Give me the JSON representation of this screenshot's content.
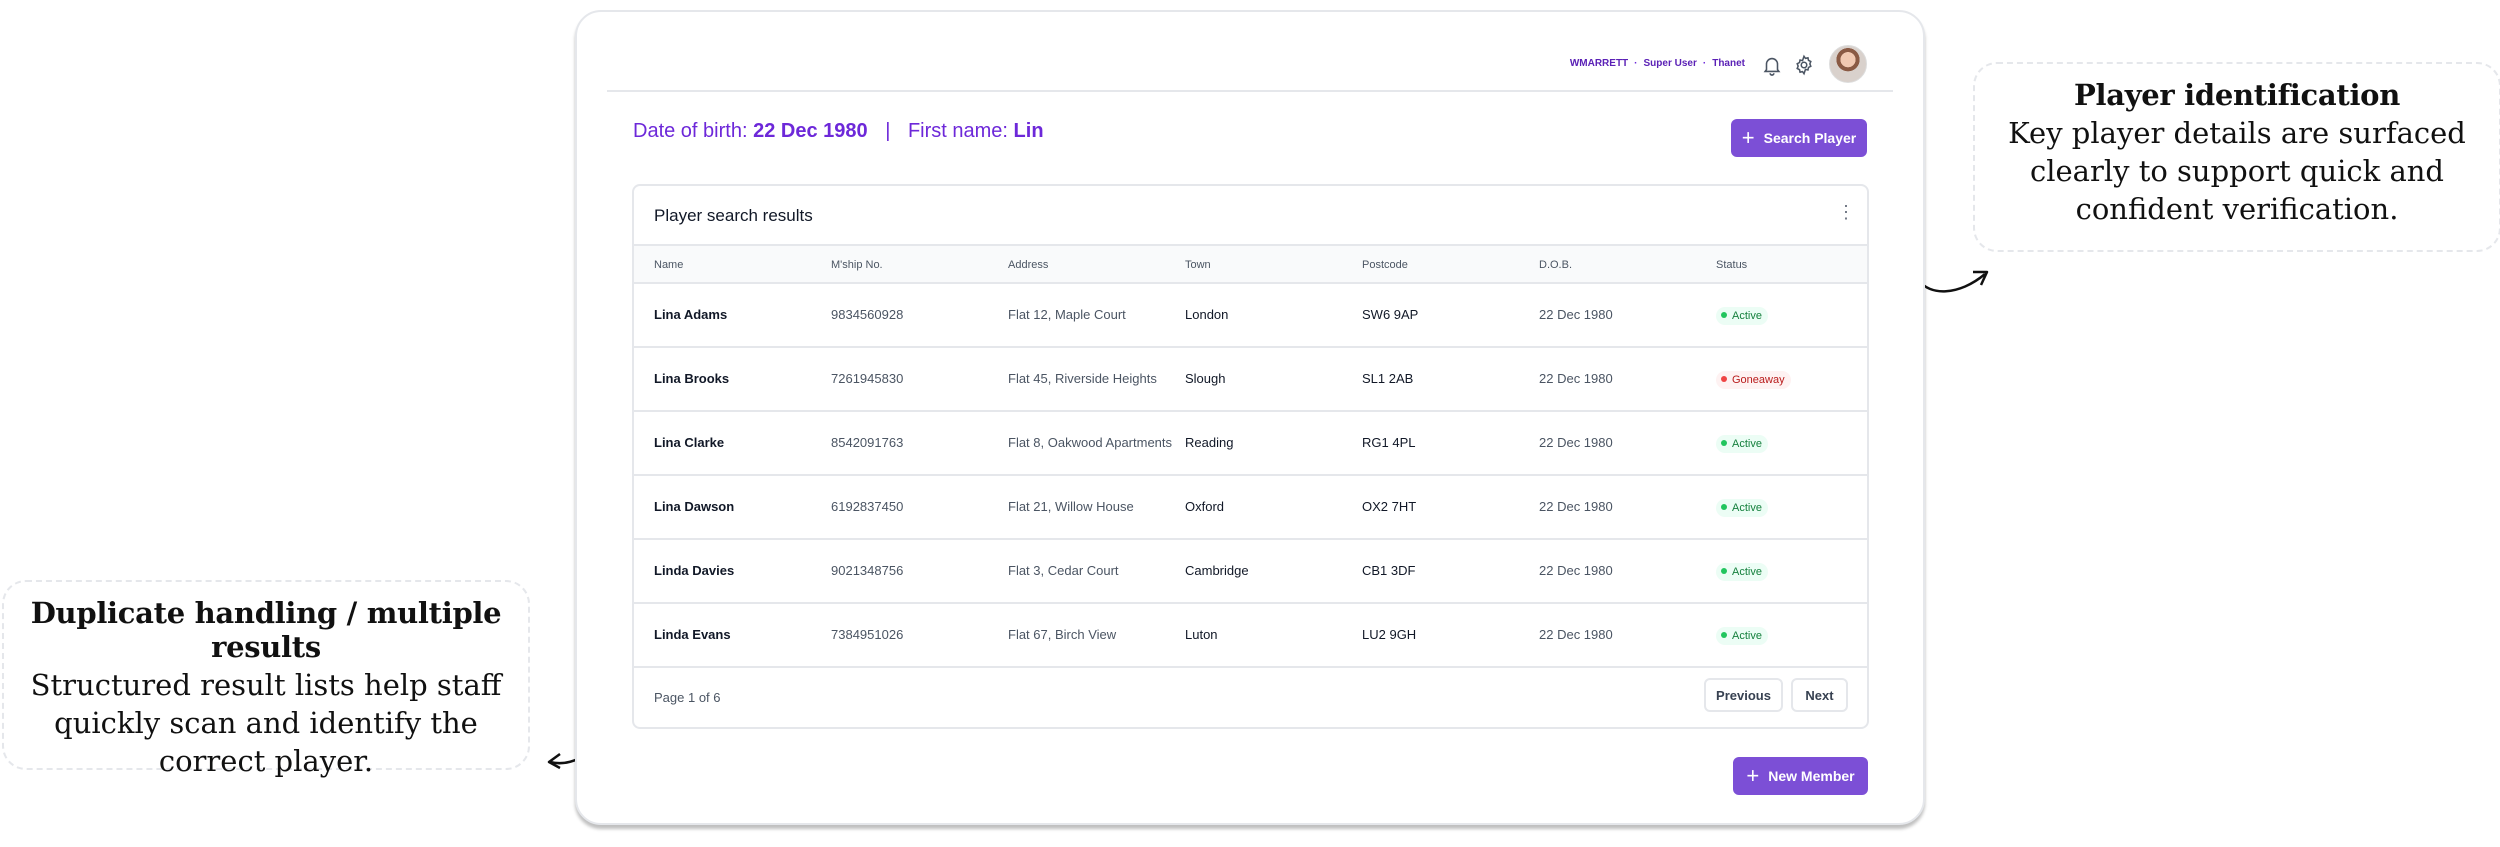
{
  "user": {
    "username": "WMARRETT",
    "role": "Super User",
    "site": "Thanet"
  },
  "search_context": {
    "dob_label": "Date of birth:",
    "dob_value": "22 Dec 1980",
    "separator": "|",
    "first_name_label": "First name:",
    "first_name_value": "Lin"
  },
  "buttons": {
    "search_player": "Search Player",
    "new_member": "New Member",
    "previous": "Previous",
    "next": "Next"
  },
  "results": {
    "title": "Player search results",
    "columns": [
      "Name",
      "M'ship No.",
      "Address",
      "Town",
      "Postcode",
      "D.O.B.",
      "Status"
    ],
    "rows": [
      {
        "name": "Lina Adams",
        "membership": "9834560928",
        "address": "Flat 12, Maple Court",
        "town": "London",
        "postcode": "SW6 9AP",
        "dob": "22 Dec 1980",
        "status": "Active"
      },
      {
        "name": "Lina Brooks",
        "membership": "7261945830",
        "address": "Flat 45, Riverside Heights",
        "town": "Slough",
        "postcode": "SL1 2AB",
        "dob": "22 Dec 1980",
        "status": "Goneaway"
      },
      {
        "name": "Lina Clarke",
        "membership": "8542091763",
        "address": "Flat 8, Oakwood Apartments",
        "town": "Reading",
        "postcode": "RG1 4PL",
        "dob": "22 Dec 1980",
        "status": "Active"
      },
      {
        "name": "Lina Dawson",
        "membership": "6192837450",
        "address": "Flat 21, Willow House",
        "town": "Oxford",
        "postcode": "OX2 7HT",
        "dob": "22 Dec 1980",
        "status": "Active"
      },
      {
        "name": "Linda Davies",
        "membership": "9021348756",
        "address": "Flat 3, Cedar Court",
        "town": "Cambridge",
        "postcode": "CB1 3DF",
        "dob": "22 Dec 1980",
        "status": "Active"
      },
      {
        "name": "Linda Evans",
        "membership": "7384951026",
        "address": "Flat 67, Birch View",
        "town": "Luton",
        "postcode": "LU2 9GH",
        "dob": "22 Dec 1980",
        "status": "Active"
      }
    ],
    "pagination": "Page 1 of 6"
  },
  "annotations": {
    "right": {
      "title": "Player identification",
      "body": "Key player details are surfaced clearly to support quick and confident verification."
    },
    "left": {
      "title": "Duplicate handling / multiple results",
      "body": "Structured result lists help staff quickly scan and identify the correct player."
    }
  },
  "icons": {
    "bell": "bell-icon",
    "gear": "gear-icon",
    "kebab": "kebab-menu-icon",
    "plus": "plus-icon"
  },
  "colors": {
    "accent": "#7c4fd6",
    "active": "#15803d",
    "goneaway": "#b91c1c"
  }
}
